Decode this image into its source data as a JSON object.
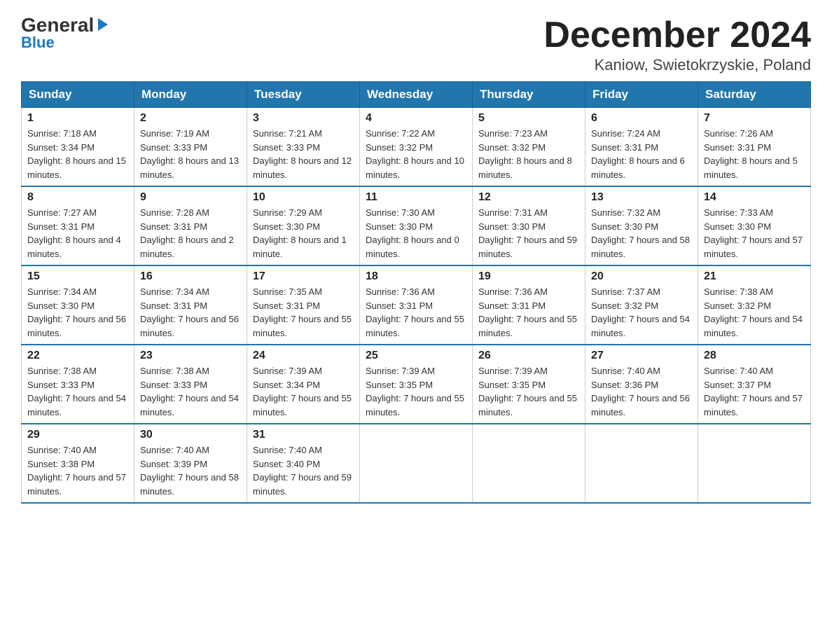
{
  "header": {
    "logo": {
      "general": "General",
      "blue": "Blue",
      "arrow": "▶"
    },
    "title": "December 2024",
    "location": "Kaniow, Swietokrzyskie, Poland"
  },
  "days_of_week": [
    "Sunday",
    "Monday",
    "Tuesday",
    "Wednesday",
    "Thursday",
    "Friday",
    "Saturday"
  ],
  "weeks": [
    [
      {
        "day": "1",
        "sunrise": "7:18 AM",
        "sunset": "3:34 PM",
        "daylight": "8 hours and 15 minutes."
      },
      {
        "day": "2",
        "sunrise": "7:19 AM",
        "sunset": "3:33 PM",
        "daylight": "8 hours and 13 minutes."
      },
      {
        "day": "3",
        "sunrise": "7:21 AM",
        "sunset": "3:33 PM",
        "daylight": "8 hours and 12 minutes."
      },
      {
        "day": "4",
        "sunrise": "7:22 AM",
        "sunset": "3:32 PM",
        "daylight": "8 hours and 10 minutes."
      },
      {
        "day": "5",
        "sunrise": "7:23 AM",
        "sunset": "3:32 PM",
        "daylight": "8 hours and 8 minutes."
      },
      {
        "day": "6",
        "sunrise": "7:24 AM",
        "sunset": "3:31 PM",
        "daylight": "8 hours and 6 minutes."
      },
      {
        "day": "7",
        "sunrise": "7:26 AM",
        "sunset": "3:31 PM",
        "daylight": "8 hours and 5 minutes."
      }
    ],
    [
      {
        "day": "8",
        "sunrise": "7:27 AM",
        "sunset": "3:31 PM",
        "daylight": "8 hours and 4 minutes."
      },
      {
        "day": "9",
        "sunrise": "7:28 AM",
        "sunset": "3:31 PM",
        "daylight": "8 hours and 2 minutes."
      },
      {
        "day": "10",
        "sunrise": "7:29 AM",
        "sunset": "3:30 PM",
        "daylight": "8 hours and 1 minute."
      },
      {
        "day": "11",
        "sunrise": "7:30 AM",
        "sunset": "3:30 PM",
        "daylight": "8 hours and 0 minutes."
      },
      {
        "day": "12",
        "sunrise": "7:31 AM",
        "sunset": "3:30 PM",
        "daylight": "7 hours and 59 minutes."
      },
      {
        "day": "13",
        "sunrise": "7:32 AM",
        "sunset": "3:30 PM",
        "daylight": "7 hours and 58 minutes."
      },
      {
        "day": "14",
        "sunrise": "7:33 AM",
        "sunset": "3:30 PM",
        "daylight": "7 hours and 57 minutes."
      }
    ],
    [
      {
        "day": "15",
        "sunrise": "7:34 AM",
        "sunset": "3:30 PM",
        "daylight": "7 hours and 56 minutes."
      },
      {
        "day": "16",
        "sunrise": "7:34 AM",
        "sunset": "3:31 PM",
        "daylight": "7 hours and 56 minutes."
      },
      {
        "day": "17",
        "sunrise": "7:35 AM",
        "sunset": "3:31 PM",
        "daylight": "7 hours and 55 minutes."
      },
      {
        "day": "18",
        "sunrise": "7:36 AM",
        "sunset": "3:31 PM",
        "daylight": "7 hours and 55 minutes."
      },
      {
        "day": "19",
        "sunrise": "7:36 AM",
        "sunset": "3:31 PM",
        "daylight": "7 hours and 55 minutes."
      },
      {
        "day": "20",
        "sunrise": "7:37 AM",
        "sunset": "3:32 PM",
        "daylight": "7 hours and 54 minutes."
      },
      {
        "day": "21",
        "sunrise": "7:38 AM",
        "sunset": "3:32 PM",
        "daylight": "7 hours and 54 minutes."
      }
    ],
    [
      {
        "day": "22",
        "sunrise": "7:38 AM",
        "sunset": "3:33 PM",
        "daylight": "7 hours and 54 minutes."
      },
      {
        "day": "23",
        "sunrise": "7:38 AM",
        "sunset": "3:33 PM",
        "daylight": "7 hours and 54 minutes."
      },
      {
        "day": "24",
        "sunrise": "7:39 AM",
        "sunset": "3:34 PM",
        "daylight": "7 hours and 55 minutes."
      },
      {
        "day": "25",
        "sunrise": "7:39 AM",
        "sunset": "3:35 PM",
        "daylight": "7 hours and 55 minutes."
      },
      {
        "day": "26",
        "sunrise": "7:39 AM",
        "sunset": "3:35 PM",
        "daylight": "7 hours and 55 minutes."
      },
      {
        "day": "27",
        "sunrise": "7:40 AM",
        "sunset": "3:36 PM",
        "daylight": "7 hours and 56 minutes."
      },
      {
        "day": "28",
        "sunrise": "7:40 AM",
        "sunset": "3:37 PM",
        "daylight": "7 hours and 57 minutes."
      }
    ],
    [
      {
        "day": "29",
        "sunrise": "7:40 AM",
        "sunset": "3:38 PM",
        "daylight": "7 hours and 57 minutes."
      },
      {
        "day": "30",
        "sunrise": "7:40 AM",
        "sunset": "3:39 PM",
        "daylight": "7 hours and 58 minutes."
      },
      {
        "day": "31",
        "sunrise": "7:40 AM",
        "sunset": "3:40 PM",
        "daylight": "7 hours and 59 minutes."
      },
      null,
      null,
      null,
      null
    ]
  ],
  "labels": {
    "sunrise": "Sunrise:",
    "sunset": "Sunset:",
    "daylight": "Daylight:"
  }
}
